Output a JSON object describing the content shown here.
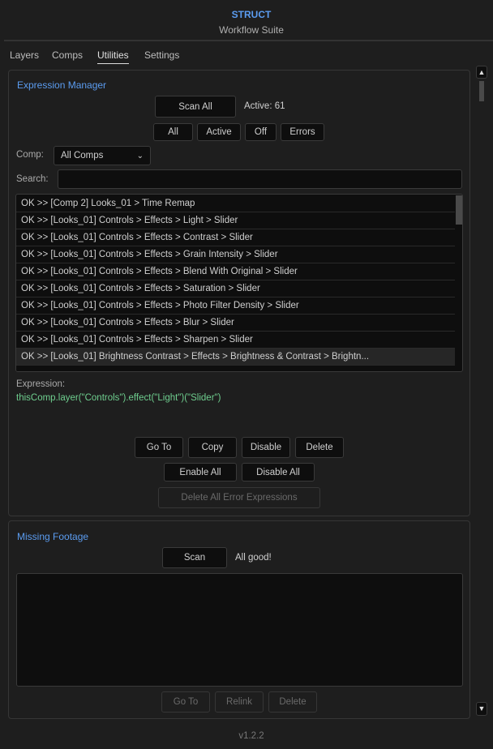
{
  "header": {
    "title": "STRUCT",
    "subtitle": "Workflow Suite"
  },
  "tabs": [
    {
      "label": "Layers"
    },
    {
      "label": "Comps"
    },
    {
      "label": "Utilities",
      "active": true
    },
    {
      "label": "Settings"
    }
  ],
  "expression_manager": {
    "title": "Expression Manager",
    "scan_all": "Scan All",
    "active_count": "Active: 61",
    "filters": [
      "All",
      "Active",
      "Off",
      "Errors"
    ],
    "comp_label": "Comp:",
    "comp_value": "All Comps",
    "search_label": "Search:",
    "search_value": "",
    "items": [
      "OK >> [Comp 2] Looks_01 > Time Remap",
      "OK >> [Looks_01] Controls > Effects > Light > Slider",
      "OK >> [Looks_01] Controls > Effects > Contrast > Slider",
      "OK >> [Looks_01] Controls > Effects > Grain Intensity > Slider",
      "OK >> [Looks_01] Controls > Effects > Blend With Original > Slider",
      "OK >> [Looks_01] Controls > Effects > Saturation > Slider",
      "OK >> [Looks_01] Controls > Effects > Photo Filter Density > Slider",
      "OK >> [Looks_01] Controls > Effects > Blur > Slider",
      "OK >> [Looks_01] Controls > Effects > Sharpen > Slider",
      "OK >> [Looks_01] Brightness Contrast > Effects > Brightness & Contrast > Brightn..."
    ],
    "selected_index": 9,
    "expression_label": "Expression:",
    "expression": "thisComp.layer(\"Controls\").effect(\"Light\")(\"Slider\")",
    "actions": [
      "Go To",
      "Copy",
      "Disable",
      "Delete"
    ],
    "enable_all": "Enable All",
    "disable_all": "Disable All",
    "delete_errors": "Delete All Error Expressions"
  },
  "missing_footage": {
    "title": "Missing Footage",
    "scan": "Scan",
    "status": "All good!",
    "actions": [
      "Go To",
      "Relink",
      "Delete"
    ]
  },
  "footer": {
    "version": "v1.2.2"
  },
  "colors": {
    "accent": "#5b9cf0",
    "expression": "#6fcf8f",
    "background": "#1e1e1e"
  }
}
